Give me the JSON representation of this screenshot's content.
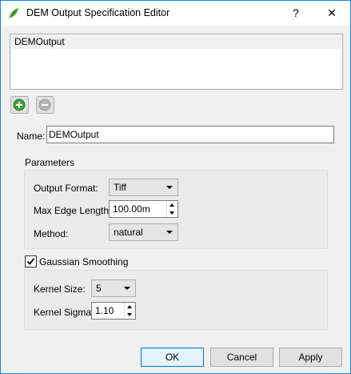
{
  "window": {
    "title": "DEM Output Specification Editor",
    "help_label": "?",
    "close_label": "✕",
    "accent": "#1883d7"
  },
  "output_list": {
    "items": [
      {
        "label": "DEMOutput",
        "selected": true
      }
    ]
  },
  "list_buttons": {
    "add_icon": "plus-green-icon",
    "remove_icon": "minus-gray-icon"
  },
  "name": {
    "label": "Name:",
    "value": "DEMOutput"
  },
  "parameters": {
    "label": "Parameters",
    "output_format": {
      "label": "Output Format:",
      "value": "Tiff"
    },
    "max_edge_length": {
      "label": "Max Edge Length:",
      "value": "100.00m"
    },
    "method": {
      "label": "Method:",
      "value": "natural"
    }
  },
  "smoothing": {
    "label": "Gaussian Smoothing",
    "checked": true,
    "kernel_size": {
      "label": "Kernel Size:",
      "value": "5"
    },
    "kernel_sigma": {
      "label": "Kernel Sigma:",
      "value": "1.10"
    }
  },
  "buttons": {
    "ok": "OK",
    "cancel": "Cancel",
    "apply": "Apply"
  },
  "colors": {
    "add_green": "#3aa335",
    "default_button_border": "#0078d7"
  }
}
